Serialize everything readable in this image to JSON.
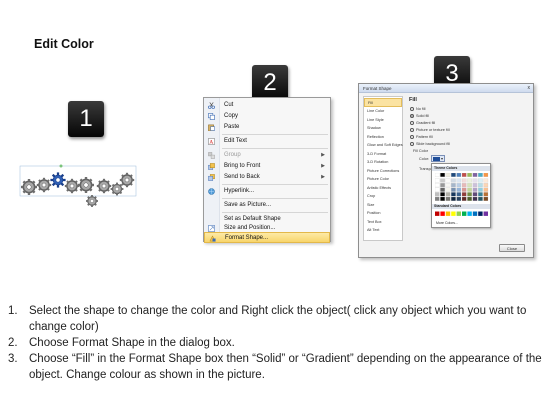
{
  "title": "Edit Color",
  "steps": [
    "1",
    "2",
    "3"
  ],
  "context_menu": {
    "items": [
      {
        "label": "Cut",
        "icon": "scissors-icon",
        "enabled": true,
        "submenu": false
      },
      {
        "label": "Copy",
        "icon": "copy-icon",
        "enabled": true,
        "submenu": false
      },
      {
        "label": "Paste",
        "icon": "paste-icon",
        "enabled": true,
        "submenu": false
      },
      {
        "label": "Edit Text",
        "icon": "edit-text-icon",
        "enabled": true,
        "submenu": false
      },
      {
        "label": "Group",
        "icon": "group-icon",
        "enabled": false,
        "submenu": true
      },
      {
        "label": "Bring to Front",
        "icon": "bring-front-icon",
        "enabled": true,
        "submenu": true
      },
      {
        "label": "Send to Back",
        "icon": "send-back-icon",
        "enabled": true,
        "submenu": true
      },
      {
        "label": "Hyperlink...",
        "icon": "hyperlink-icon",
        "enabled": true,
        "submenu": false
      },
      {
        "label": "Save as Picture...",
        "icon": "",
        "enabled": true,
        "submenu": false
      },
      {
        "label": "Set as Default Shape",
        "icon": "",
        "enabled": true,
        "submenu": false
      },
      {
        "label": "Size and Position...",
        "icon": "size-icon",
        "enabled": true,
        "submenu": false
      },
      {
        "label": "Format Shape...",
        "icon": "format-shape-icon",
        "enabled": true,
        "submenu": false,
        "highlighted": true
      }
    ]
  },
  "dialog": {
    "title": "Format Shape",
    "close_symbol": "x",
    "nav": [
      "Fill",
      "Line Color",
      "Line Style",
      "Shadow",
      "Reflection",
      "Glow and Soft Edges",
      "3-D Format",
      "3-D Rotation",
      "Picture Corrections",
      "Picture Color",
      "Artistic Effects",
      "Crop",
      "Size",
      "Position",
      "Text Box",
      "Alt Text"
    ],
    "active_nav": "Fill",
    "pane_title": "Fill",
    "options": [
      {
        "label": "No fill",
        "selected": false
      },
      {
        "label": "Solid fill",
        "selected": true
      },
      {
        "label": "Gradient fill",
        "selected": false
      },
      {
        "label": "Picture or texture fill",
        "selected": false
      },
      {
        "label": "Pattern fill",
        "selected": false
      },
      {
        "label": "Slide background fill",
        "selected": false
      }
    ],
    "fill_color_label": "Fill Color",
    "color_label": "Color:",
    "transparency_label": "Transparency:",
    "theme_colors_label": "Theme Colors",
    "standard_colors_label": "Standard Colors",
    "more_colors_label": "More Colors...",
    "close_button": "Close",
    "theme_columns": [
      "#ffffff",
      "#000000",
      "#eeece1",
      "#1f497d",
      "#4f81bd",
      "#c0504d",
      "#9bbb59",
      "#8064a2",
      "#4bacc6",
      "#f79646"
    ],
    "standard_colors": [
      "#c00000",
      "#ff0000",
      "#ffc000",
      "#ffff00",
      "#92d050",
      "#00b050",
      "#00b0f0",
      "#0070c0",
      "#002060",
      "#7030a0"
    ]
  },
  "instructions": [
    {
      "num": "1.",
      "text": "Select the shape to change the color and Right click the object( click any object which you want to change color)"
    },
    {
      "num": "2.",
      "text": "Choose Format Shape in the dialog box."
    },
    {
      "num": "3.",
      "text": "Choose “Fill” in the Format Shape box then “Solid” or “Gradient” depending on the appearance of the object. Change colour as shown in the picture."
    }
  ]
}
